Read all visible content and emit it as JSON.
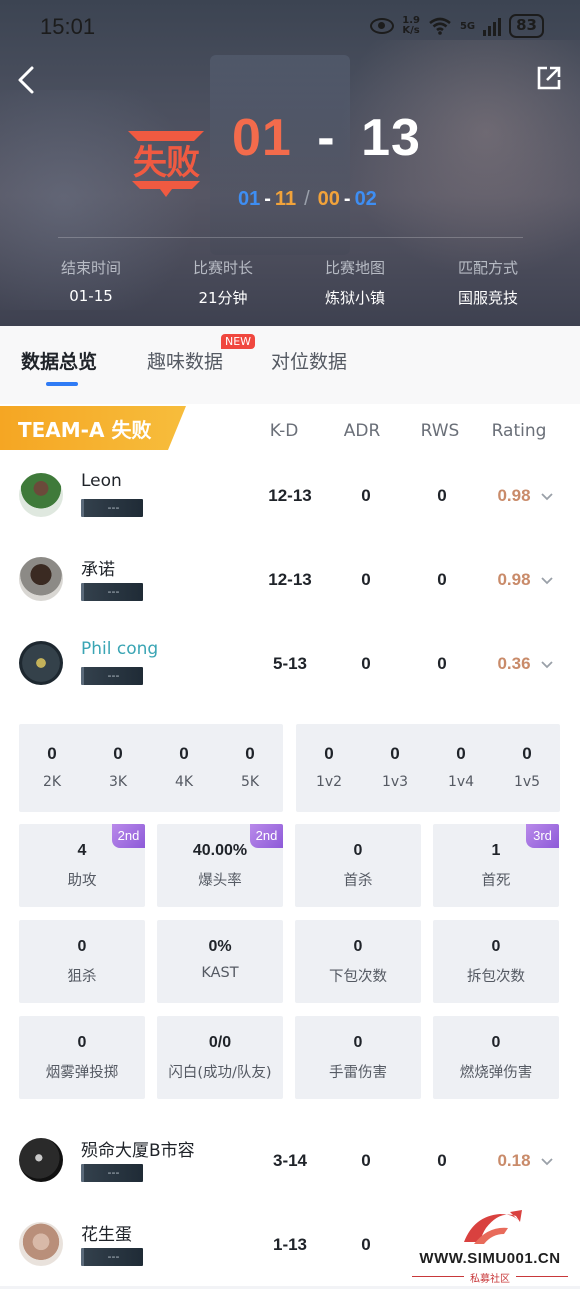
{
  "status_bar": {
    "time": "15:01",
    "speed_top": "1.9",
    "speed_unit": "K/s",
    "network": "5G",
    "battery": "83"
  },
  "match": {
    "result_label": "失败",
    "score_left": "01",
    "score_dash": "-",
    "score_right": "13",
    "half1_left": "01",
    "half1_right": "11",
    "half2_left": "00",
    "half2_right": "02",
    "info": [
      {
        "label": "结束时间",
        "value": "01-15"
      },
      {
        "label": "比赛时长",
        "value": "21分钟"
      },
      {
        "label": "比赛地图",
        "value": "炼狱小镇"
      },
      {
        "label": "匹配方式",
        "value": "国服竞技"
      }
    ]
  },
  "tabs": [
    {
      "label": "数据总览",
      "active": true
    },
    {
      "label": "趣味数据",
      "badge": "NEW"
    },
    {
      "label": "对位数据"
    }
  ],
  "team": {
    "name": "TEAM-A",
    "result": "失败",
    "columns": [
      "K-D",
      "ADR",
      "RWS",
      "Rating"
    ]
  },
  "players": [
    {
      "name": "Leon",
      "rank": "---",
      "kd": "12-13",
      "adr": "0",
      "rws": "0",
      "rating": "0.98"
    },
    {
      "name": "承诺",
      "rank": "---",
      "kd": "12-13",
      "adr": "0",
      "rws": "0",
      "rating": "0.98"
    },
    {
      "name": "Phil cong",
      "rank": "---",
      "kd": "5-13",
      "adr": "0",
      "rws": "0",
      "rating": "0.36"
    },
    {
      "name": "殒命大厦B市容",
      "rank": "---",
      "kd": "3-14",
      "adr": "0",
      "rws": "0",
      "rating": "0.18"
    },
    {
      "name": "花生蛋",
      "rank": "---",
      "kd": "1-13",
      "adr": "0"
    }
  ],
  "detail": {
    "multikills": [
      {
        "value": "0",
        "label": "2K"
      },
      {
        "value": "0",
        "label": "3K"
      },
      {
        "value": "0",
        "label": "4K"
      },
      {
        "value": "0",
        "label": "5K"
      }
    ],
    "clutches": [
      {
        "value": "0",
        "label": "1v2"
      },
      {
        "value": "0",
        "label": "1v3"
      },
      {
        "value": "0",
        "label": "1v4"
      },
      {
        "value": "0",
        "label": "1v5"
      }
    ],
    "stats": [
      {
        "value": "4",
        "label": "助攻",
        "tag": "2nd"
      },
      {
        "value": "40.00%",
        "label": "爆头率",
        "tag": "2nd"
      },
      {
        "value": "0",
        "label": "首杀"
      },
      {
        "value": "1",
        "label": "首死",
        "tag": "3rd"
      },
      {
        "value": "0",
        "label": "狙杀"
      },
      {
        "value": "0%",
        "label": "KAST"
      },
      {
        "value": "0",
        "label": "下包次数"
      },
      {
        "value": "0",
        "label": "拆包次数"
      },
      {
        "value": "0",
        "label": "烟雾弹投掷"
      },
      {
        "value": "0/0",
        "label": "闪白(成功/队友)"
      },
      {
        "value": "0",
        "label": "手雷伤害"
      },
      {
        "value": "0",
        "label": "燃烧弹伤害"
      }
    ]
  },
  "watermark": {
    "site": "WWW.SIMU001.CN",
    "sub": "私募社区"
  },
  "colors": {
    "accent": "#2f7bf5",
    "loss": "#f05a41",
    "rating": "#c98b6a",
    "rank_tag": "#9b6ae0"
  }
}
